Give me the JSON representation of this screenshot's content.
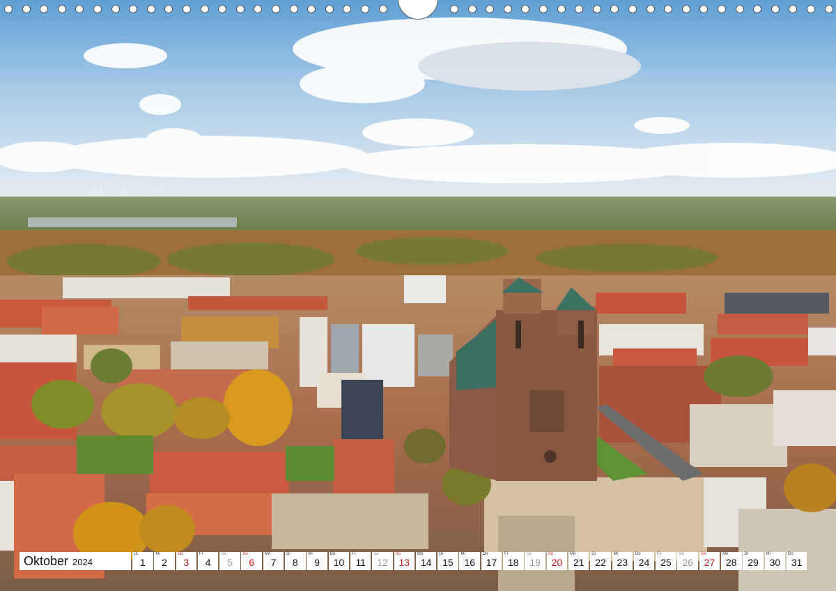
{
  "calendar": {
    "month": "Oktober",
    "year": "2024",
    "days": [
      {
        "wd": "Di",
        "num": "1",
        "type": "normal"
      },
      {
        "wd": "Mi",
        "num": "2",
        "type": "normal"
      },
      {
        "wd": "Do",
        "num": "3",
        "type": "hol"
      },
      {
        "wd": "Fr",
        "num": "4",
        "type": "normal"
      },
      {
        "wd": "Sa",
        "num": "5",
        "type": "sat"
      },
      {
        "wd": "So",
        "num": "6",
        "type": "sun"
      },
      {
        "wd": "Mo",
        "num": "7",
        "type": "normal"
      },
      {
        "wd": "Di",
        "num": "8",
        "type": "normal"
      },
      {
        "wd": "Mi",
        "num": "9",
        "type": "normal"
      },
      {
        "wd": "Do",
        "num": "10",
        "type": "normal"
      },
      {
        "wd": "Fr",
        "num": "11",
        "type": "normal"
      },
      {
        "wd": "Sa",
        "num": "12",
        "type": "sat"
      },
      {
        "wd": "So",
        "num": "13",
        "type": "sun"
      },
      {
        "wd": "Mo",
        "num": "14",
        "type": "normal"
      },
      {
        "wd": "Di",
        "num": "15",
        "type": "normal"
      },
      {
        "wd": "Mi",
        "num": "16",
        "type": "normal"
      },
      {
        "wd": "Do",
        "num": "17",
        "type": "normal"
      },
      {
        "wd": "Fr",
        "num": "18",
        "type": "normal"
      },
      {
        "wd": "Sa",
        "num": "19",
        "type": "sat"
      },
      {
        "wd": "So",
        "num": "20",
        "type": "sun"
      },
      {
        "wd": "Mo",
        "num": "21",
        "type": "normal"
      },
      {
        "wd": "Di",
        "num": "22",
        "type": "normal"
      },
      {
        "wd": "Mi",
        "num": "23",
        "type": "normal"
      },
      {
        "wd": "Do",
        "num": "24",
        "type": "normal"
      },
      {
        "wd": "Fr",
        "num": "25",
        "type": "normal"
      },
      {
        "wd": "Sa",
        "num": "26",
        "type": "sat"
      },
      {
        "wd": "So",
        "num": "27",
        "type": "sun"
      },
      {
        "wd": "Mo",
        "num": "28",
        "type": "normal"
      },
      {
        "wd": "Di",
        "num": "29",
        "type": "normal"
      },
      {
        "wd": "Mi",
        "num": "30",
        "type": "normal"
      },
      {
        "wd": "Do",
        "num": "31",
        "type": "normal"
      }
    ]
  },
  "colors": {
    "holiday_red": "#d01b1b",
    "saturday_gray": "#9a9a9a"
  }
}
